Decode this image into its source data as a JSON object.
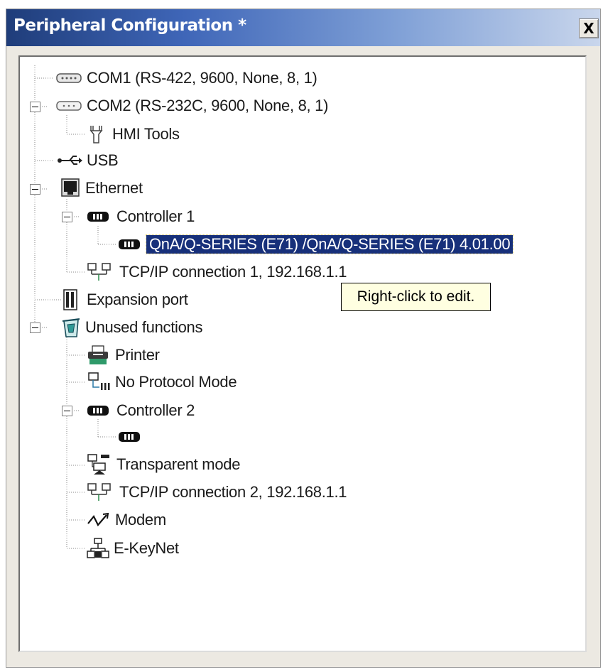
{
  "window": {
    "title": "Peripheral Configuration *",
    "close_glyph": "X"
  },
  "tree": {
    "com1": "COM1 (RS-422, 9600, None, 8, 1)",
    "com2": "COM2 (RS-232C, 9600, None, 8, 1)",
    "hmi_tools": "HMI Tools",
    "usb": "USB",
    "ethernet": "Ethernet",
    "controller1": "Controller 1",
    "qna_item": "QnA/Q-SERIES (E71) /QnA/Q-SERIES (E71) 4.01.00",
    "tcpip1": "TCP/IP connection 1, 192.168.1.1",
    "expansion_port": "Expansion port",
    "unused_functions": "Unused functions",
    "printer": "Printer",
    "no_protocol_mode": "No Protocol Mode",
    "controller2": "Controller 2",
    "transparent_mode": "Transparent mode",
    "tcpip2": "TCP/IP connection 2, 192.168.1.1",
    "modem": "Modem",
    "ekeynet": "E-KeyNet"
  },
  "tooltip": {
    "text": "Right-click to edit."
  },
  "colors": {
    "selection": "#17307a",
    "titlebar_start": "#1f3d7a",
    "tooltip_bg": "#ffffe1"
  }
}
